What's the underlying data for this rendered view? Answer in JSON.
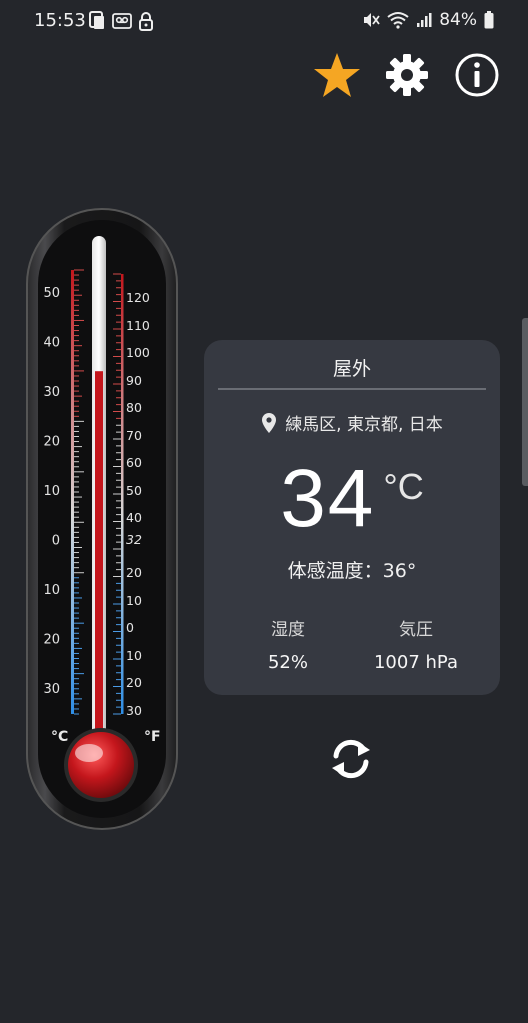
{
  "status_bar": {
    "time": "15:53",
    "battery": "84%"
  },
  "top_actions": {
    "star_icon": "star-icon",
    "settings_icon": "gear-icon",
    "info_icon": "info-icon",
    "star_color": "#f5a623"
  },
  "thermometer": {
    "celsius_labels": [
      "50",
      "40",
      "30",
      "20",
      "10",
      "0",
      "10",
      "20",
      "30"
    ],
    "fahrenheit_labels": [
      "120",
      "110",
      "100",
      "90",
      "80",
      "70",
      "60",
      "50",
      "40",
      "32",
      "20",
      "10",
      "0",
      "10",
      "20",
      "30"
    ],
    "celsius_unit": "°C",
    "fahrenheit_unit": "°F",
    "current_celsius": 34,
    "mercury_color": "#c4161c"
  },
  "card": {
    "title": "屋外",
    "location": "練馬区, 東京都, 日本",
    "temperature": "34",
    "unit": "°C",
    "feels_like": "体感温度：36°",
    "humidity_label": "湿度",
    "humidity_value": "52%",
    "pressure_label": "気圧",
    "pressure_value": "1007 hPa"
  },
  "refresh_icon": "refresh-icon"
}
